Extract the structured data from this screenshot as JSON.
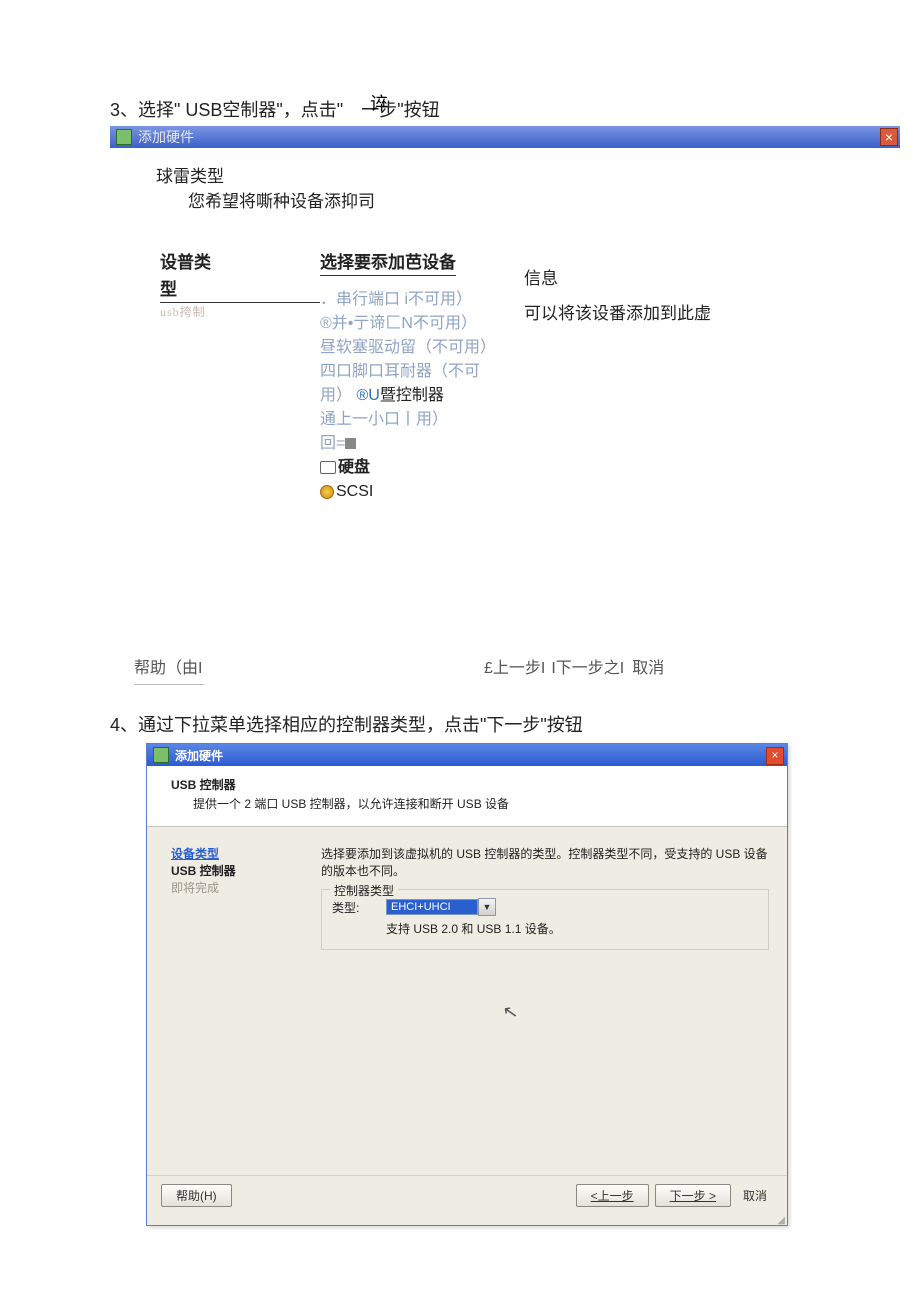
{
  "step3": {
    "line": "3、选择\" USB空制器\"，点击\"　一步\"按钮",
    "overlay": "谇"
  },
  "dlg1": {
    "title": "添加硬件",
    "hdr1": "球雷类型",
    "hdr2": "您希望将嘶种设备添抑司",
    "left_label_a": "设普类",
    "left_label_b": "型",
    "left_usb": "usb挎制",
    "mid_label": "选择要忝加芭设备",
    "opts": {
      "o1": "．串行端口 i不可用）",
      "o2": "®并•亍谛匚N不可用）",
      "o3": "昼软塞驱动留（不可用）",
      "o4": "四口脚口耳耐器（不可用）",
      "o5a": "®U",
      "o5b": "暨控制器",
      "o6": "通上一小口丨用）",
      "o7a": "回=",
      "o8": "硬盘",
      "o9": "SCSI"
    },
    "right_label": "信息",
    "right_text": "可以将该设番添加到此虚",
    "help": "帮助（由I",
    "back": "£上一步I",
    "next": "I下一步之I",
    "cancel": "取消"
  },
  "step4": "4、通过下拉菜单选择相应的控制器类型，点击\"下一步\"按钮",
  "dlg2": {
    "title": "添加硬件",
    "hdr1": "USB 控制器",
    "hdr2": "提供一个 2 端口 USB 控制器，以允许连接和断开 USB 设备",
    "side": {
      "a": "设备类型",
      "b": "USB 控制器",
      "c": "即将完成"
    },
    "desc": "选择要添加到该虚拟机的 USB 控制器的类型。控制器类型不同，受支持的 USB 设备的版本也不同。",
    "fieldset_legend": "控制器类型",
    "type_label": "类型:",
    "combo_value": "EHCI+UHCI",
    "support": "支持 USB 2.0 和 USB 1.1 设备。",
    "help_btn": "帮助(H)",
    "back_btn": "<上一步",
    "next_btn": "下一步 >",
    "cancel_btn": "取消"
  }
}
